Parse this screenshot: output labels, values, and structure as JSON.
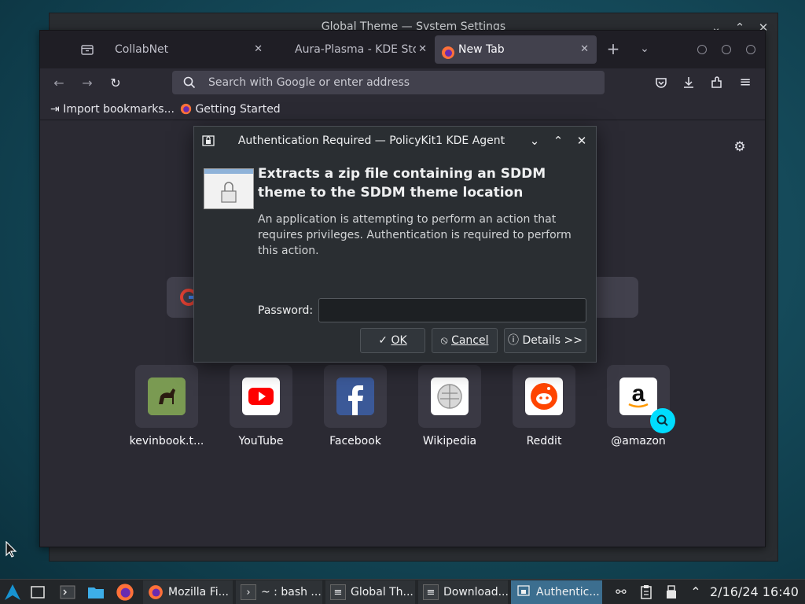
{
  "bg_window": {
    "title": "Global Theme — System Settings"
  },
  "firefox": {
    "tabs": [
      {
        "label": "CollabNet"
      },
      {
        "label": "Aura-Plasma - KDE Sto"
      },
      {
        "label": "New Tab"
      }
    ],
    "url_placeholder": "Search with Google or enter address",
    "bookmarks": [
      {
        "label": "Import bookmarks..."
      },
      {
        "label": "Getting Started"
      }
    ],
    "shortcuts": [
      {
        "label": "kevinbook.t..."
      },
      {
        "label": "YouTube"
      },
      {
        "label": "Facebook"
      },
      {
        "label": "Wikipedia"
      },
      {
        "label": "Reddit"
      },
      {
        "label": "@amazon"
      }
    ]
  },
  "dialog": {
    "title": "Authentication Required — PolicyKit1 KDE Agent",
    "heading": "Extracts a zip file containing an SDDM theme to the SDDM theme location",
    "description": "An application is attempting to perform an action that requires privileges. Authentication is required to perform this action.",
    "password_label": "Password:",
    "password_value": "",
    "buttons": {
      "ok": "OK",
      "cancel": "Cancel",
      "details": "Details >>"
    }
  },
  "taskbar": {
    "tasks": [
      {
        "label": "Mozilla Fi..."
      },
      {
        "label": "~ : bash ..."
      },
      {
        "label": "Global Th..."
      },
      {
        "label": "Download..."
      },
      {
        "label": "Authentic..."
      }
    ],
    "date": "2/16/24",
    "time": "16:40"
  },
  "colors": {
    "accent": "#3c6e8f",
    "search_badge": "#00ddff"
  }
}
